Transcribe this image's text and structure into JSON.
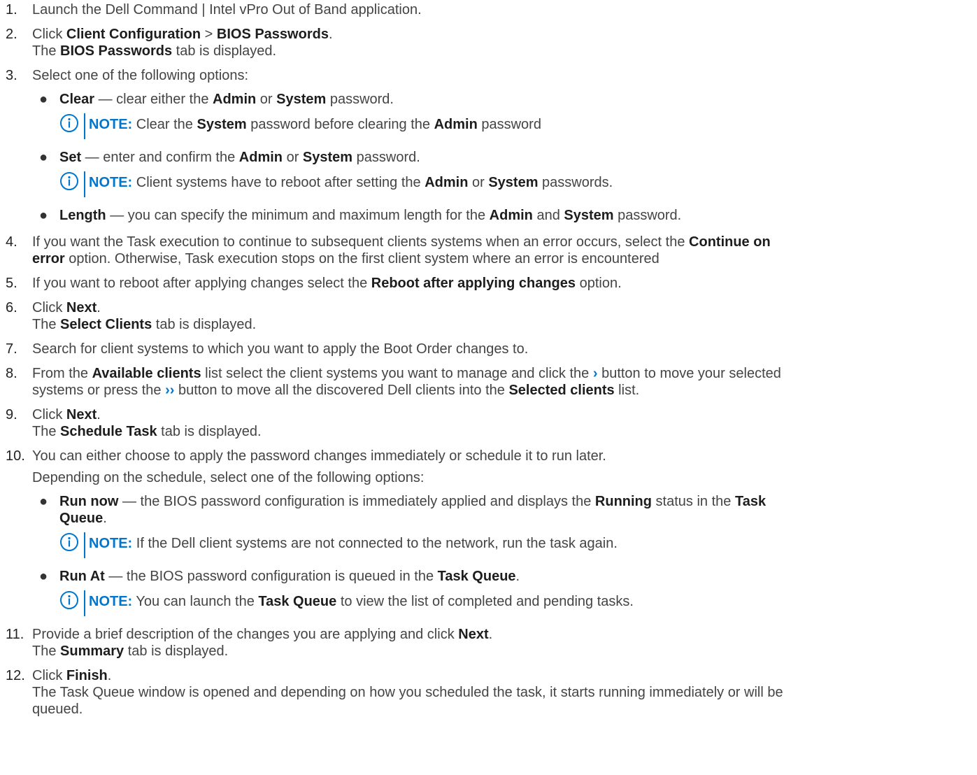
{
  "steps": [
    {
      "n": "1.",
      "t": "Launch the Dell Command | Intel vPro Out of Band application."
    },
    {
      "n": "2.",
      "click": "Click ",
      "b1": "Client Configuration",
      "sep": " > ",
      "b2": "BIOS Passwords",
      "end": ".",
      "l2a": "The ",
      "l2b": "BIOS Passwords",
      "l2c": " tab is displayed."
    },
    {
      "n": "3.",
      "t": "Select one of the following options:"
    },
    {
      "n": "4.",
      "a": "If you want the Task execution to continue to subsequent clients systems when an error occurs, select the ",
      "b": "Continue on",
      "b2": "error",
      "c": " option. Otherwise, Task execution stops on the first client system where an error is encountered"
    },
    {
      "n": "5.",
      "a": "If you want to reboot after applying changes select the ",
      "b": "Reboot after applying changes",
      "c": " option."
    },
    {
      "n": "6.",
      "a": "Click ",
      "b": "Next",
      "c": ".",
      "l2a": "The ",
      "l2b": "Select Clients",
      "l2c": " tab is displayed."
    },
    {
      "n": "7.",
      "t": "Search for client systems to which you want to apply the Boot Order changes to."
    },
    {
      "n": "8.",
      "a": "From the ",
      "b": "Available clients",
      "c": " list select the client systems you want to manage and click the ",
      "chev1": "›",
      "d": " button to move your selected",
      "e": "systems or press the ",
      "chev2": "››",
      "f": " button to move all the discovered Dell clients into the ",
      "g": "Selected clients",
      "h": " list."
    },
    {
      "n": "9.",
      "a": "Click ",
      "b": "Next",
      "c": ".",
      "l2a": "The ",
      "l2b": "Schedule Task",
      "l2c": " tab is displayed."
    },
    {
      "n": "10.",
      "t": "You can either choose to apply the password changes immediately or schedule it to run later.",
      "t2": "Depending on the schedule, select one of the following options:"
    },
    {
      "n": "11.",
      "a": "Provide a brief description of the changes you are applying and click ",
      "b": "Next",
      "c": ".",
      "l2a": "The ",
      "l2b": "Summary",
      "l2c": " tab is displayed."
    },
    {
      "n": "12.",
      "a": "Click ",
      "b": "Finish",
      "c": ".",
      "l2": "The Task Queue window is opened and depending on how you scheduled the task, it starts running immediately or will be",
      "l3": "queued."
    }
  ],
  "step3_options": [
    {
      "b": "Clear",
      "a": " — clear either the ",
      "b2": "Admin",
      "o": " or ",
      "b3": "System",
      "e": " password.",
      "note": {
        "label": "NOTE:",
        "a": " Clear the ",
        "b": "System",
        "c": " password before clearing the ",
        "d": "Admin",
        "e": " password"
      }
    },
    {
      "b": "Set",
      "a": " — enter and confirm the ",
      "b2": "Admin",
      "o": " or ",
      "b3": "System",
      "e": " password.",
      "note": {
        "label": "NOTE:",
        "a": " Client systems have to reboot after setting the ",
        "b": "Admin",
        "c": " or ",
        "d": "System",
        "e": " passwords."
      }
    },
    {
      "b": "Length",
      "a": " — you can specify the minimum and maximum length for the ",
      "b2": "Admin",
      "o": " and ",
      "b3": "System",
      "e": " password."
    }
  ],
  "step10_options": [
    {
      "b": "Run now",
      "a": " — the BIOS password configuration is immediately applied and displays the ",
      "b2": "Running",
      "o": " status in the ",
      "b3": "Task",
      "b4": "Queue",
      "e": ".",
      "note": {
        "label": "NOTE:",
        "a": " If the Dell client systems are not connected to the network, run the task again."
      }
    },
    {
      "b": "Run At",
      "a": " — the BIOS password configuration is queued in the ",
      "b2": "Task Queue",
      "e": ".",
      "note": {
        "label": "NOTE:",
        "a": " You can launch the ",
        "b": "Task Queue",
        "c": " to view the list of completed and pending tasks."
      }
    }
  ],
  "colors": {
    "accent": "#0076ce",
    "text": "#444444"
  },
  "icons": {
    "note": "info-circle-icon",
    "bullet": "bullet-dot-icon"
  }
}
